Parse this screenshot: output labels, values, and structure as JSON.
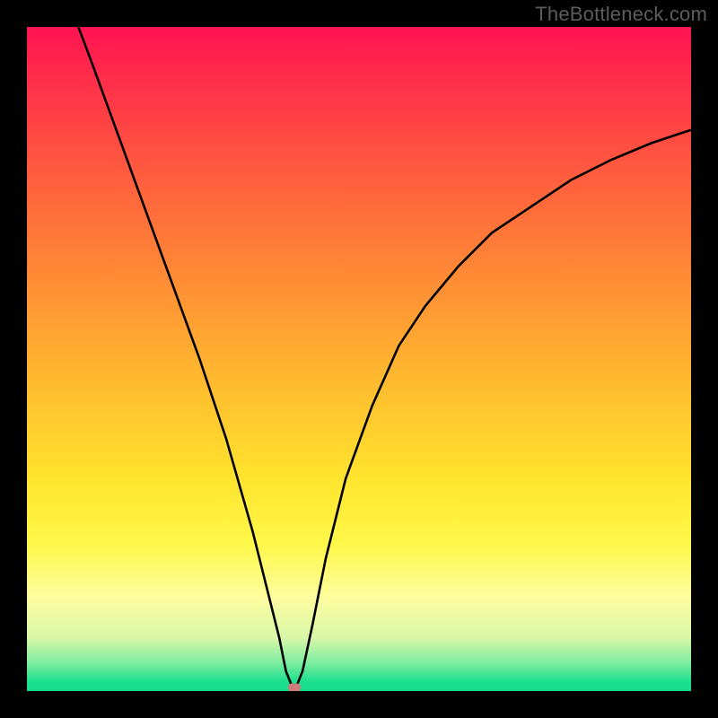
{
  "watermark": "TheBottleneck.com",
  "chart_data": {
    "type": "line",
    "title": "",
    "xlabel": "",
    "ylabel": "",
    "xlim": [
      0,
      100
    ],
    "ylim": [
      0,
      100
    ],
    "grid": false,
    "legend": false,
    "series": [
      {
        "name": "curve",
        "x": [
          7,
          10,
          14,
          18,
          22,
          26,
          30,
          34,
          36,
          38,
          39,
          40,
          40.5,
          41.5,
          43,
          45,
          48,
          52,
          56,
          60,
          65,
          70,
          76,
          82,
          88,
          94,
          100
        ],
        "y": [
          102,
          94,
          83,
          72,
          61,
          50,
          38,
          24,
          16,
          8,
          3,
          0.5,
          0.5,
          3,
          10,
          20,
          32,
          43,
          52,
          58,
          64,
          69,
          73,
          77,
          80,
          82.5,
          84.5
        ]
      }
    ],
    "marker": {
      "x": 40.3,
      "y": 0.5
    },
    "gradient_stops": [
      {
        "pos": 0,
        "color": "#ff1452"
      },
      {
        "pos": 0.2,
        "color": "#ff5540"
      },
      {
        "pos": 0.44,
        "color": "#ff9e32"
      },
      {
        "pos": 0.68,
        "color": "#ffe42e"
      },
      {
        "pos": 0.86,
        "color": "#fdfda0"
      },
      {
        "pos": 0.96,
        "color": "#76ec9e"
      },
      {
        "pos": 1.0,
        "color": "#15db87"
      }
    ]
  }
}
